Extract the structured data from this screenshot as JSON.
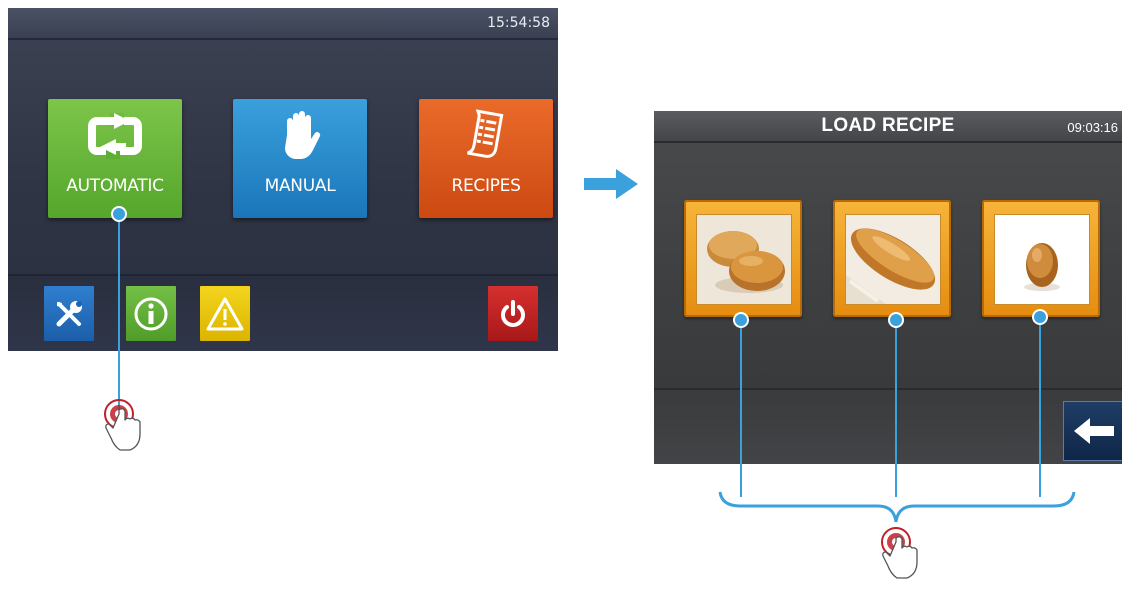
{
  "screen1": {
    "clock": "15:54:58",
    "tiles": [
      {
        "label": "AUTOMATIC",
        "icon": "repeat-icon",
        "color": "#5fae34"
      },
      {
        "label": "MANUAL",
        "icon": "hand-icon",
        "color": "#1f82c6"
      },
      {
        "label": "RECIPES",
        "icon": "recipe-list-icon",
        "color": "#d9541a"
      }
    ],
    "bottom_buttons": [
      {
        "icon": "tools-icon",
        "color": "#1f64b0"
      },
      {
        "icon": "info-icon",
        "color": "#5ba636"
      },
      {
        "icon": "warning-icon",
        "color": "#ecc80c"
      },
      {
        "icon": "power-icon",
        "color": "#c02424"
      }
    ]
  },
  "screen2": {
    "title": "LOAD RECIPE",
    "clock": "09:03:16",
    "recipes": [
      {
        "icon": "buns-photo"
      },
      {
        "icon": "baguette-roll-photo"
      },
      {
        "icon": "round-bread-roll-photo"
      }
    ],
    "back_icon": "back-arrow-icon"
  },
  "annotations": {
    "arrow_color": "#3aa1dc",
    "callout_color": "#3aa1dc",
    "touch_color": "#c0202a"
  }
}
